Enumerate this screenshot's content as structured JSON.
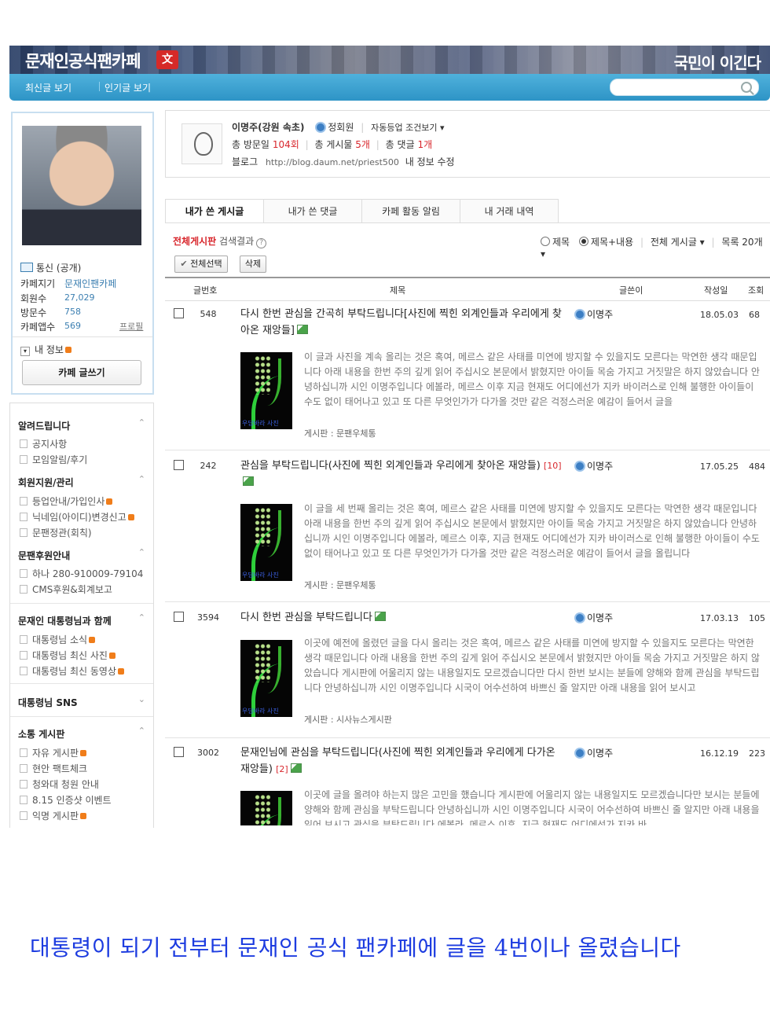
{
  "header": {
    "cafe_title": "문재인공식팬카페",
    "logo_char": "文",
    "slogan": "국민이 이긴다",
    "nav": [
      "최신글 보기",
      "인기글 보기"
    ],
    "search_placeholder": ""
  },
  "profile": {
    "status": "통신 (공개)",
    "labels": [
      "카페지기",
      "회원수",
      "방문수",
      "카페앱수"
    ],
    "values": [
      "문재인팬카페",
      "27,029",
      "758",
      "569"
    ],
    "profile_link": "프로필",
    "my_info": "내 정보",
    "write_button": "카페 글쓰기"
  },
  "menu": {
    "sections": [
      {
        "title": "알려드립니다",
        "items": [
          "공지사항",
          "모임알림/후기"
        ]
      },
      {
        "title": "회원지원/관리",
        "items": [
          "등업안내/가입인사",
          "닉네임(아이디)변경신고",
          "문팬정관(회칙)"
        ]
      },
      {
        "title": "문팬후원안내",
        "items": [
          "하나 280-910009-79104",
          "CMS후원&회계보고"
        ]
      },
      {
        "title": "문재인 대통령님과 함께",
        "items": [
          "대통령님 소식",
          "대통령님 최신 사진",
          "대통령님 최신 동영상"
        ]
      },
      {
        "title": "대통령님 SNS",
        "items": []
      },
      {
        "title": "소통 게시판",
        "items": [
          "자유 게시판",
          "현안 팩트체크",
          "청와대 청원 안내",
          "8.15 인증샷 이벤트",
          "익명 게시판"
        ]
      }
    ]
  },
  "user": {
    "name": "이명주(강원 속초)",
    "grade": "정회원",
    "auto_grade": "자동등업 조건보기 ▾",
    "visits_label": "총 방문일",
    "visits": "104회",
    "posts_label": "총 게시물",
    "posts": "5개",
    "comments_label": "총 댓글",
    "comments": "1개",
    "blog_label": "블로그",
    "blog_url": "http://blog.daum.net/priest500",
    "edit_info": "내 정보 수정"
  },
  "tabs": [
    "내가 쓴 게시글",
    "내가 쓴 댓글",
    "카페 활동 알림",
    "내 거래 내역"
  ],
  "list": {
    "board_name": "전체게시판",
    "result_label": "검색결과",
    "radio_title": "제목",
    "radio_title_body": "제목+내용",
    "all_posts_select": "전체 게시글 ▾",
    "list_size_select": "목록 20개 ▾",
    "select_all_btn": "전체선택",
    "delete_btn": "삭제",
    "headers": {
      "num": "글번호",
      "title": "제목",
      "author": "글쓴이",
      "date": "작성일",
      "views": "조회"
    }
  },
  "posts": [
    {
      "num": "548",
      "title": "다시 한번 관심을 간곡히 부탁드립니다[사진에 찍힌 외계인들과 우리에게 찾아온 재앙들]",
      "comments": "",
      "author": "이명주",
      "date": "18.05.03",
      "views": "68",
      "body": "이 글과 사진을 계속 올리는 것은 혹여, 메르스 같은 사태를 미연에 방지할 수 있을지도 모른다는 막연한 생각 때문입니다 아래 내용을 한번 주의 깊게 읽어 주십시오 본문에서 밝혔지만 아이들 목숨 가지고 거짓말은 하지 않았습니다 안녕하십니까 시인 이명주입니다 에볼라, 메르스 이후 지금 현재도 어디에선가 지카 바이러스로 인해 불행한 아이들이 수도 없이 태어나고 있고 또 다른 무엇인가가 다가올 것만 같은 걱정스러운 예감이 들어서 글을",
      "board": "게시판 : 문팬우체통",
      "thumb_caption": "우담바라 사진"
    },
    {
      "num": "242",
      "title": "관심을 부탁드립니다(사진에 찍힌 외계인들과 우리에게 찾아온 재앙들)",
      "comments": "[10]",
      "author": "이명주",
      "date": "17.05.25",
      "views": "484",
      "body": "이 글을 세 번째 올리는 것은 혹여, 메르스 같은 사태를 미연에 방지할 수 있을지도 모른다는 막연한 생각 때문입니다 아래 내용을 한번 주의 깊게 읽어 주십시오 본문에서 밝혔지만 아이들 목숨 가지고 거짓말은 하지 않았습니다 안녕하십니까 시인 이명주입니다 에볼라, 메르스 이후, 지금 현재도 어디에선가 지카 바이러스로 인해 불행한 아이들이 수도 없이 태어나고 있고 또 다른 무엇인가가 다가올 것만 같은 걱정스러운 예감이 들어서 글을 올립니다",
      "board": "게시판 : 문팬우체통",
      "thumb_caption": "우담바라 사진"
    },
    {
      "num": "3594",
      "title": "다시 한번 관심을 부탁드립니다",
      "comments": "",
      "author": "이명주",
      "date": "17.03.13",
      "views": "105",
      "body": "이곳에 예전에 올렸던 글을 다시 올리는 것은 혹여, 메르스 같은 사태를 미연에 방지할 수 있을지도 모른다는 막연한 생각 때문입니다 아래 내용을 한번 주의 깊게 읽어 주십시오 본문에서 밝혔지만 아이들 목숨 가지고 거짓말은 하지 않았습니다 게시판에 어울리지 않는 내용일지도 모르겠습니다만 다시 한번 보시는 분들에 양해와 함께 관심을 부탁드립니다 안녕하십니까 시인 이명주입니다 시국이 어수선하여 바쁘신 줄 알지만 아래 내용을 읽어 보시고",
      "board": "게시판 : 시사뉴스게시판",
      "thumb_caption": "우담바라 사진"
    },
    {
      "num": "3002",
      "title": "문재인님에 관심을 부탁드립니다(사진에 찍힌 외계인들과 우리에게 다가온 재앙들)",
      "comments": "[2]",
      "author": "이명주",
      "date": "16.12.19",
      "views": "223",
      "body": "이곳에 글을 올려야 하는지 많은 고민을 했습니다 게시판에 어울리지 않는 내용일지도 모르겠습니다만 보시는 분들에 양해와 함께 관심을 부탁드립니다 안녕하십니까 시인 이명주입니다 시국이 어수선하여 바쁘신 줄 알지만 아래 내용을 읽어 보시고 관심을 부탁드립니다 에볼라, 메르스 이후, 지금 현재도 어디에선가 지카 바",
      "board": "",
      "thumb_caption": ""
    }
  ],
  "caption": "대통령이 되기 전부터 문재인 공식 팬카페에 글을 4번이나 올렸습니다",
  "colors": {
    "accent": "#2e94c6",
    "red": "#d8262c",
    "caption": "#1d3ce0"
  }
}
